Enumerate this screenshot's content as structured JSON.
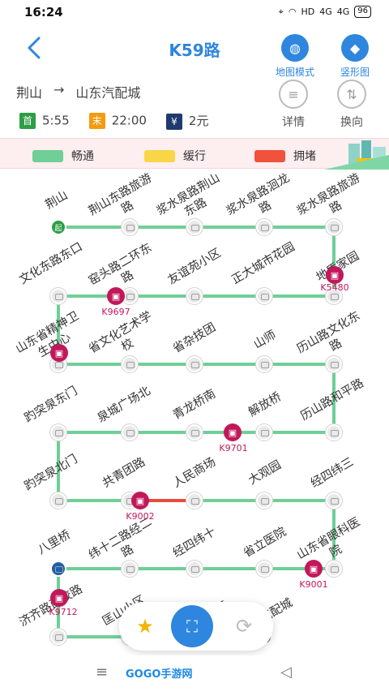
{
  "status_bar": {
    "time": "16:24",
    "battery": "96",
    "signal": "4G",
    "hd": "HD"
  },
  "header": {
    "title": "K59路",
    "map_mode_label": "地图模式",
    "vertical_label": "竖形图"
  },
  "route": {
    "from": "荆山",
    "arrow": "→",
    "to": "山东汽配城"
  },
  "info": {
    "first_tag": "首",
    "first_time": "5:55",
    "last_tag": "末",
    "last_time": "22:00",
    "fare_tag": "¥",
    "fare": "2元"
  },
  "actions": {
    "details_label": "详情",
    "reverse_label": "换向"
  },
  "legend": {
    "smooth": "畅通",
    "slow": "缓行",
    "jam": "拥堵",
    "colors": {
      "smooth": "#6fcf97",
      "slow": "#f9d648",
      "jam": "#f0523c"
    }
  },
  "stops": [
    "荆山",
    "荆山东路旅游路",
    "浆水泉路荆山东路",
    "浆水泉路洄龙路",
    "浆水泉路旅游路",
    "地质家园",
    "正大城市花园",
    "友谊苑小区",
    "窑头路二环东路",
    "文化东路东口",
    "山东省精神卫生中心",
    "省文化艺术学校",
    "省杂技团",
    "山师",
    "历山路文化东路",
    "历山路和平路",
    "解放桥",
    "青龙桥南",
    "泉城广场北",
    "趵突泉东门",
    "趵突泉北门",
    "共青团路",
    "人民商场",
    "大观园",
    "经四纬三",
    "山东省眼科医院",
    "省立医院",
    "经四纬十",
    "纬十二路经二路",
    "八里桥",
    "济齐路西校路",
    "匡山小区",
    "三西",
    "汽配城"
  ],
  "start_badge": "起",
  "buses": [
    "K5480",
    "K9697",
    "K9701",
    "K9002",
    "K9001",
    "K9712"
  ],
  "bottom": {
    "logo": "GOGO手游网",
    "favorite_icon": "star-icon",
    "scan_icon": "scan-icon",
    "refresh_icon": "refresh-icon"
  }
}
